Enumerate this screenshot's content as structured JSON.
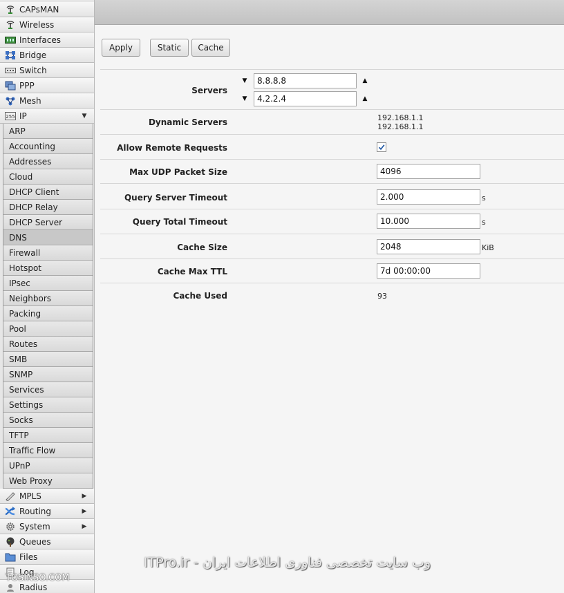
{
  "sidebar": {
    "items_top": [
      {
        "label": "CAPsMAN",
        "icon": "capsman-icon"
      },
      {
        "label": "Wireless",
        "icon": "wireless-icon"
      },
      {
        "label": "Interfaces",
        "icon": "interfaces-icon"
      },
      {
        "label": "Bridge",
        "icon": "bridge-icon"
      },
      {
        "label": "Switch",
        "icon": "switch-icon"
      },
      {
        "label": "PPP",
        "icon": "ppp-icon"
      },
      {
        "label": "Mesh",
        "icon": "mesh-icon"
      },
      {
        "label": "IP",
        "icon": "ip-icon",
        "expanded": true
      }
    ],
    "ip_submenu": [
      "ARP",
      "Accounting",
      "Addresses",
      "Cloud",
      "DHCP Client",
      "DHCP Relay",
      "DHCP Server",
      "DNS",
      "Firewall",
      "Hotspot",
      "IPsec",
      "Neighbors",
      "Packing",
      "Pool",
      "Routes",
      "SMB",
      "SNMP",
      "Services",
      "Settings",
      "Socks",
      "TFTP",
      "Traffic Flow",
      "UPnP",
      "Web Proxy"
    ],
    "ip_active": "DNS",
    "items_bottom": [
      {
        "label": "MPLS",
        "icon": "mpls-icon",
        "has_submenu": true
      },
      {
        "label": "Routing",
        "icon": "routing-icon",
        "has_submenu": true
      },
      {
        "label": "System",
        "icon": "system-icon",
        "has_submenu": true
      },
      {
        "label": "Queues",
        "icon": "queues-icon"
      },
      {
        "label": "Files",
        "icon": "files-icon"
      },
      {
        "label": "Log",
        "icon": "log-icon"
      },
      {
        "label": "Radius",
        "icon": "radius-icon"
      }
    ]
  },
  "toolbar": {
    "apply_label": "Apply",
    "static_label": "Static",
    "cache_label": "Cache"
  },
  "form": {
    "servers_label": "Servers",
    "servers": [
      "8.8.8.8",
      "4.2.2.4"
    ],
    "dynamic_servers_label": "Dynamic Servers",
    "dynamic_servers": [
      "192.168.1.1",
      "192.168.1.1"
    ],
    "allow_remote_label": "Allow Remote Requests",
    "allow_remote_checked": true,
    "max_udp_label": "Max UDP Packet Size",
    "max_udp_value": "4096",
    "query_server_timeout_label": "Query Server Timeout",
    "query_server_timeout_value": "2.000",
    "query_server_timeout_unit": "s",
    "query_total_timeout_label": "Query Total Timeout",
    "query_total_timeout_value": "10.000",
    "query_total_timeout_unit": "s",
    "cache_size_label": "Cache Size",
    "cache_size_value": "2048",
    "cache_size_unit": "KiB",
    "cache_max_ttl_label": "Cache Max TTL",
    "cache_max_ttl_value": "7d 00:00:00",
    "cache_used_label": "Cache Used",
    "cache_used_value": "93"
  },
  "watermark": {
    "left": "TOSINSO.COM",
    "right": "ITPro.ir - وب سایت تخصصی فناوری اطلاعات ایران"
  },
  "colors": {
    "accent_checkbox": "#2a5fa8",
    "topbar": "#c8c8c8",
    "sidebar_sub_panel": "#9a9a9a"
  }
}
